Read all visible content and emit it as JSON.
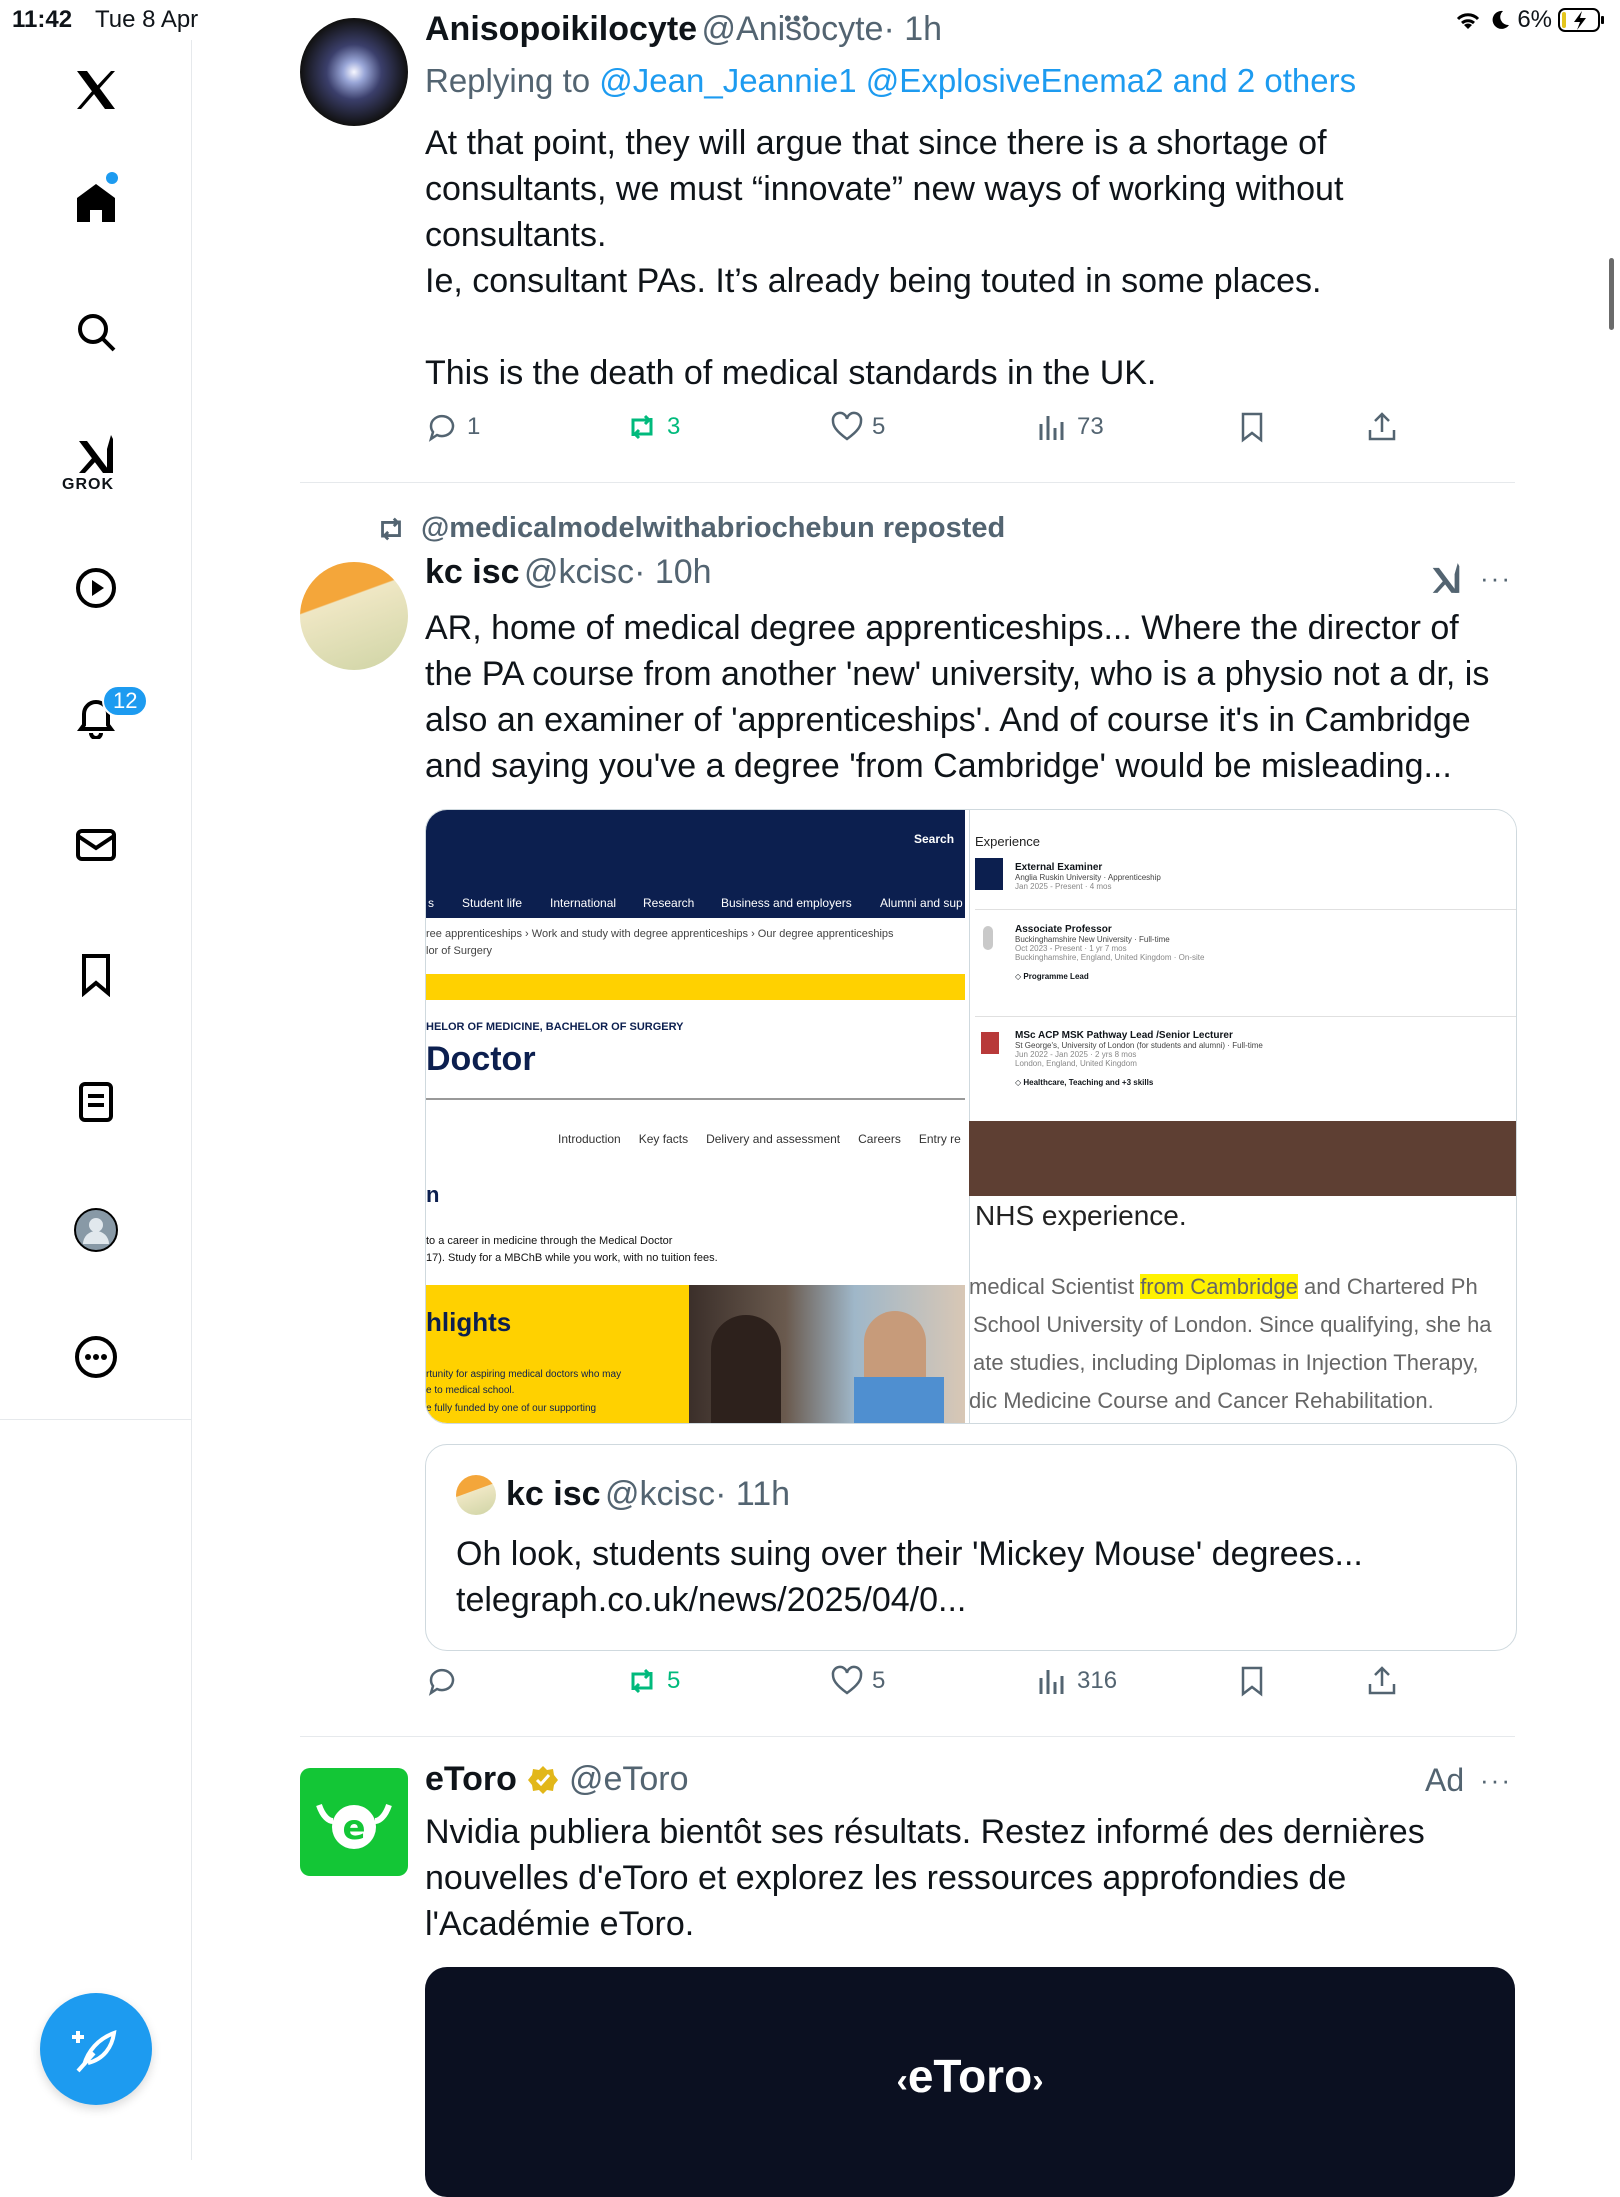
{
  "status_bar": {
    "time": "11:42",
    "date": "Tue 8 Apr",
    "battery": "6%"
  },
  "sidebar": {
    "grok_label": "GROK",
    "notifications_badge": "12"
  },
  "tweet1": {
    "name": "Anisopoikilocyte",
    "handle": "@Anisocyte",
    "time": "· 1h",
    "replying_prefix": "Replying to",
    "replying_to": "@Jean_Jeannie1 @ExplosiveEnema2 and 2 others",
    "text_lines": [
      "At that point, they will argue that since there is a shortage of",
      "consultants, we must “innovate” new ways of working without",
      "consultants.",
      "Ie, consultant PAs. It’s already being touted in some places.",
      "",
      "This is the death of medical standards in the UK."
    ],
    "replies": "1",
    "reposts": "3",
    "likes": "5",
    "views": "73"
  },
  "tweet2": {
    "repost_label": "@medicalmodelwithabriochebun reposted",
    "name": "kc isc",
    "handle": "@kcisc",
    "time": "· 10h",
    "text_lines": [
      "AR, home of medical degree apprenticeships... Where the director of",
      "the PA course from another 'new' university, who is a physio not a dr, is",
      "also an examiner of 'apprenticeships'. And of course it's in Cambridge",
      "and saying you've a degree 'from Cambridge' would be misleading..."
    ],
    "replies": "",
    "reposts": "5",
    "likes": "5",
    "views": "316",
    "media_left": {
      "search": "Search",
      "nav": [
        "Student life",
        "International",
        "Research",
        "Business and employers",
        "Alumni and sup"
      ],
      "nav_first": "s",
      "breadcrumb": "ree apprenticeships  ›  Work and study with degree apprenticeships  ›  Our degree apprenticeships",
      "breadcrumb2": "lor of Surgery",
      "degree": "HELOR OF MEDICINE, BACHELOR OF SURGERY",
      "title": "Doctor",
      "tabs": [
        "Introduction",
        "Key facts",
        "Delivery and assessment",
        "Careers",
        "Entry re"
      ],
      "intro_h": "n",
      "intro_1": "to a career in medicine through the Medical Doctor",
      "intro_2": "17). Study for a MBChB while you work, with no tuition fees.",
      "highlights": "hlights",
      "hl_1": "rtunity for aspiring medical doctors who may",
      "hl_2": "e to medical school.",
      "hl_3": "e fully funded by one of our supporting"
    },
    "media_right": {
      "heading": "Experience",
      "jobs": [
        {
          "title": "External Examiner",
          "org": "Anglia Ruskin University · Apprenticeship",
          "dates": "Jan 2025 - Present · 4 mos",
          "loc": "",
          "skill": ""
        },
        {
          "title": "Associate Professor",
          "org": "Buckinghamshire New University · Full-time",
          "dates": "Oct 2023 - Present · 1 yr 7 mos",
          "loc": "Buckinghamshire, England, United Kingdom · On-site",
          "skill": "Programme Lead"
        },
        {
          "title": "MSc ACP MSK Pathway Lead /Senior Lecturer",
          "org": "St George's, University of London (for students and alumni) · Full-time",
          "dates": "Jun 2022 - Jan 2025 · 2 yrs 8 mos",
          "loc": "London, England, United Kingdom",
          "skill": "Healthcare, Teaching and +3 skills"
        }
      ],
      "nhs": "NHS experience.",
      "bio_1_pre": "medical Scientist ",
      "bio_1_hl": "from Cambridge",
      "bio_1_post": " and Chartered Ph",
      "bio_2": "School University of London. Since qualifying, she ha",
      "bio_3": "ate studies, including Diplomas in Injection Therapy,",
      "bio_4": "dic Medicine Course and Cancer Rehabilitation."
    },
    "quote": {
      "name": "kc isc",
      "handle": "@kcisc",
      "time": "· 11h",
      "text_1": "Oh look, students suing over their 'Mickey Mouse' degrees...",
      "text_2": "telegraph.co.uk/news/2025/04/0..."
    }
  },
  "tweet3": {
    "name": "eToro",
    "handle": "@eToro",
    "ad": "Ad",
    "text_lines": [
      "Nvidia publiera bientôt ses résultats. Restez informé des dernières",
      "nouvelles d'eToro et explorez les ressources approfondies de",
      "l'Académie eToro."
    ],
    "logo_text": "eToro"
  },
  "colors": {
    "accent": "#1d9bf0",
    "repost_green": "#00ba7c",
    "etoro_green": "#13c636"
  }
}
